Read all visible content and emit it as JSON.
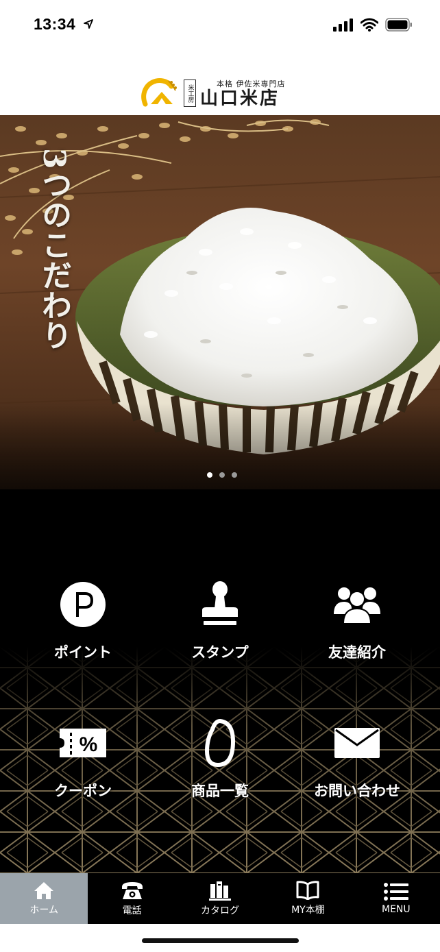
{
  "status_bar": {
    "time": "13:34",
    "icons": [
      "location-arrow-icon",
      "cellular-signal-icon",
      "wifi-icon",
      "battery-icon"
    ]
  },
  "header": {
    "logo_badge": "米工房",
    "logo_subtitle": "本格 伊佐米専門店",
    "logo_name": "山口米店"
  },
  "hero": {
    "headline": "3つのこだわり",
    "slide_count": 3,
    "active_slide": 1
  },
  "menu": {
    "items": [
      {
        "label": "ポイント",
        "icon": "point-icon"
      },
      {
        "label": "スタンプ",
        "icon": "stamp-icon"
      },
      {
        "label": "友達紹介",
        "icon": "friends-icon"
      },
      {
        "label": "クーポン",
        "icon": "coupon-icon"
      },
      {
        "label": "商品一覧",
        "icon": "rice-grain-icon"
      },
      {
        "label": "お問い合わせ",
        "icon": "mail-icon"
      }
    ]
  },
  "tab_bar": {
    "tabs": [
      {
        "label": "ホーム",
        "icon": "home-icon",
        "active": true
      },
      {
        "label": "電話",
        "icon": "phone-icon",
        "active": false
      },
      {
        "label": "カタログ",
        "icon": "catalog-icon",
        "active": false
      },
      {
        "label": "MY本棚",
        "icon": "book-icon",
        "active": false
      },
      {
        "label": "MENU",
        "icon": "menu-icon",
        "active": false
      }
    ]
  },
  "colors": {
    "background": "#000000",
    "active_tab": "#9ba4ab",
    "logo_accent": "#f0b400",
    "pattern_gold": "#8a7a5a"
  }
}
